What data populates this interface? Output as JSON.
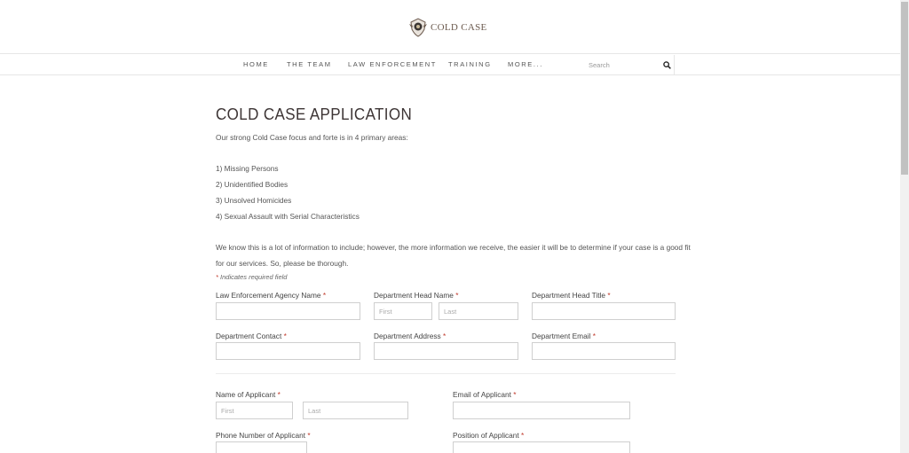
{
  "header": {
    "logo_text": "COLD CASE"
  },
  "nav": {
    "items": [
      "HOME",
      "THE TEAM",
      "LAW ENFORCEMENT",
      "TRAINING",
      "MORE..."
    ],
    "search_placeholder": "Search"
  },
  "page": {
    "title": "COLD CASE APPLICATION",
    "intro": "Our strong Cold Case focus and forte is in 4 primary areas:",
    "areas": [
      "1) Missing Persons",
      "2) Unidentified Bodies",
      "3) Unsolved Homicides",
      "4) Sexual Assault with Serial Characteristics"
    ],
    "info_line1": "We know this is a lot of information to include; however, the more information we receive, the easier it will be to determine if your case is a good fit",
    "info_line2": "for our services. So, please be thorough.",
    "required_note": "Indicates required field",
    "required_mark": "*"
  },
  "form": {
    "agency_name": {
      "label": "Law Enforcement Agency Name",
      "value": ""
    },
    "dept_head_name": {
      "label": "Department Head Name",
      "first_placeholder": "First",
      "last_placeholder": "Last"
    },
    "dept_head_title": {
      "label": "Department Head Title",
      "value": ""
    },
    "dept_contact": {
      "label": "Department Contact",
      "value": ""
    },
    "dept_address": {
      "label": "Department Address",
      "value": ""
    },
    "dept_email": {
      "label": "Department Email",
      "value": ""
    },
    "applicant_name": {
      "label": "Name of Applicant",
      "first_placeholder": "First",
      "last_placeholder": "Last"
    },
    "applicant_email": {
      "label": "Email of Applicant",
      "value": ""
    },
    "applicant_phone": {
      "label": "Phone Number of Applicant",
      "value": ""
    },
    "applicant_position": {
      "label": "Position of Applicant",
      "value": ""
    }
  },
  "colors": {
    "required": "#c0392b",
    "logo_text": "#6b5a4e",
    "title": "#3d3535"
  }
}
